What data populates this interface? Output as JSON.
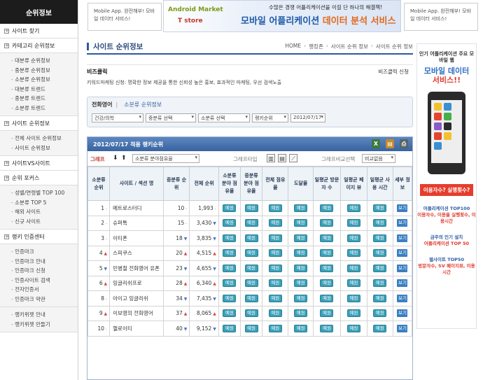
{
  "sidebar": {
    "title": "순위정보",
    "sections": [
      {
        "label": "사이트 찾기",
        "items": []
      },
      {
        "label": "카테고리 순위정보",
        "items": [
          "대분류 순위정보",
          "중분류 순위정보",
          "소분류 순위정보",
          "대분류 트렌드",
          "중분류 트렌드",
          "소분류 트렌드"
        ]
      },
      {
        "label": "사이트 순위정보",
        "items": [
          "전체 사이트 순위정보",
          "사이트 순위정보"
        ]
      },
      {
        "label": "사이트VS사이트",
        "items": []
      },
      {
        "label": "순위 포커스",
        "items": [
          "성별/연령별 TOP 100",
          "소분류 TOP 5",
          "해외 사이트",
          "신규 사이트"
        ]
      },
      {
        "label": "랭키 인증센터",
        "items": [
          "인증마크",
          "인증마크 안내",
          "인증마크 신청",
          "인증사이트 검색",
          "전자인증서",
          "인증마크 약관"
        ]
      },
      {
        "label": "",
        "items": [
          "랭키위젯 안내",
          "랭키위젯 만들기"
        ]
      }
    ]
  },
  "top_ads": {
    "left": "Mobile App. 완전해부! 모바일 데이터 서비스!",
    "right": "Mobile App. 완전해부! 모바일 데이터 서비스!",
    "banner_logo1": "Android Market",
    "banner_logo2": "T store",
    "banner_line1": "수많은 경쟁 어플리케이션을 이길 단 하나의 해결책!",
    "banner_line2a": "모바일 어플리케이션",
    "banner_line2b": "데이터 분석 서비스"
  },
  "page": {
    "title": "사이트 순위정보",
    "breadcrumb": [
      "HOME",
      "랭킹존",
      "사이트 순위 정보",
      "사이트 순위 정보"
    ]
  },
  "biz": {
    "name": "비즈클릭",
    "link": "비즈클릭 신청",
    "desc": "키워드마케팅 신청: 명확한 정보 제공을 통한 신뢰성 높은 홍보, 효과적인 마케팅, 우선 검색노출"
  },
  "filter": {
    "current": "전화영어",
    "link": "소분류 순위정보",
    "selects": [
      "건강/의학",
      "중분류 선택",
      "소분류 선택",
      "랭키순위",
      "2012/07/17"
    ]
  },
  "ranking": {
    "header": "2012/07/17 적용 랭키순위",
    "graph_label": "그래프",
    "graph_select": "소분류 분야점유율",
    "graph_type_label": "그래프타입",
    "compare_label": "그래프비교선택",
    "compare_select": "비교없음",
    "columns": [
      "소분류 순위",
      "사이트 / 섹션 명",
      "중분류 순위",
      "전체 순위",
      "소분류 분야 점유율",
      "중분류 분야 점유율",
      "전체 점유율",
      "도달율",
      "일평균 방문자 수",
      "일평균 페이지 뷰",
      "일평균 사용 시간",
      "세부 정보"
    ],
    "btn_label": "예원",
    "detail_label": "보기",
    "rows": [
      {
        "rank": "1",
        "chg": "-",
        "name": "메트로스터디",
        "mid": "10",
        "mc": "eq",
        "all": "1,993",
        "ac": "eq"
      },
      {
        "rank": "2",
        "chg": "-",
        "name": "슈퍼톡",
        "mid": "15",
        "mc": "eq",
        "all": "3,430",
        "ac": "dn"
      },
      {
        "rank": "3",
        "chg": "-",
        "name": "이티폰",
        "mid": "18",
        "mc": "dn",
        "all": "3,835",
        "ac": "dn"
      },
      {
        "rank": "4",
        "chg": "▲",
        "name": "스피쿠스",
        "mid": "20",
        "mc": "up",
        "all": "4,515",
        "ac": "up"
      },
      {
        "rank": "5",
        "chg": "▼",
        "name": "민병철 전화영어 유폰",
        "mid": "23",
        "mc": "dn",
        "all": "4,655",
        "ac": "dn"
      },
      {
        "rank": "6",
        "chg": "▲",
        "name": "잉글리쉬프로",
        "mid": "28",
        "mc": "up",
        "all": "6,340",
        "ac": "up"
      },
      {
        "rank": "8",
        "chg": "-",
        "name": "아이고 잉글리쉬",
        "mid": "34",
        "mc": "dn",
        "all": "7,435",
        "ac": "dn"
      },
      {
        "rank": "9",
        "chg": "▲",
        "name": "이보영의 전화영어",
        "mid": "37",
        "mc": "up",
        "all": "8,065",
        "ac": "up"
      },
      {
        "rank": "10",
        "chg": "-",
        "name": "헬로이티",
        "mid": "40",
        "mc": "dn",
        "all": "9,152",
        "ac": "dn"
      }
    ]
  },
  "right_ad": {
    "line1": "인기 어플리케이션 주요 모바일 웹",
    "line2": "모바일 데이터",
    "line3": "서비스!!",
    "cta": "이용자수? 실행횟수?",
    "list": [
      {
        "h": "어플리케이션 TOP100",
        "d": "이용자수, 이용율 실행횟수, 이용시간"
      },
      {
        "h": "금주의 인기 설치",
        "d": "어플리케이션 TOP 50"
      },
      {
        "h": "웹사이트 TOP50",
        "d": "방문자수, SV 페이지뷰, 이용시간"
      }
    ]
  }
}
